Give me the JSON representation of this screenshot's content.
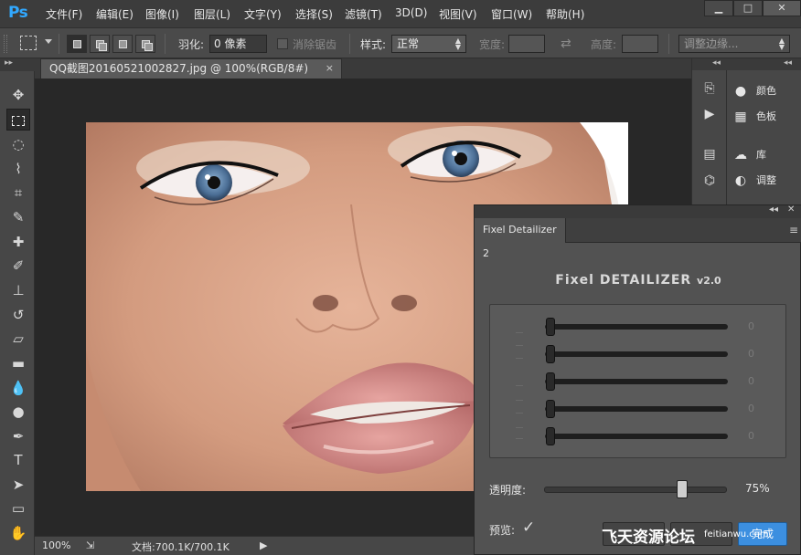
{
  "app": {
    "logo": "Ps"
  },
  "menu": [
    "文件(F)",
    "编辑(E)",
    "图像(I)",
    "图层(L)",
    "文字(Y)",
    "选择(S)",
    "滤镜(T)",
    "3D(D)",
    "视图(V)",
    "窗口(W)",
    "帮助(H)"
  ],
  "window_controls": {
    "minimize": "▁",
    "maximize": "□",
    "close": "✕"
  },
  "options": {
    "feather_label": "羽化:",
    "feather_value": "0 像素",
    "antialias_label": "消除锯齿",
    "style_label": "样式:",
    "style_value": "正常",
    "width_label": "宽度:",
    "height_label": "高度:",
    "refine_edge_button": "调整边缘..."
  },
  "document": {
    "tab_title": "QQ截图20160521002827.jpg @ 100%(RGB/8#)",
    "tab_close": "×"
  },
  "status": {
    "zoom": "100%",
    "doc_size": "文档:700.1K/700.1K"
  },
  "dock": {
    "panels": [
      {
        "label": "颜色",
        "icon": "palette-icon",
        "glyph": "●"
      },
      {
        "label": "色板",
        "icon": "swatches-icon",
        "glyph": "▦"
      },
      {
        "label": "库",
        "icon": "library-icon",
        "glyph": "☁"
      },
      {
        "label": "调整",
        "icon": "adjustments-icon",
        "glyph": "◐"
      }
    ]
  },
  "plugin": {
    "tab_label": "Fixel Detailizer 2",
    "title": "Fixel DETAILIZER",
    "version": "v2.0",
    "sliders": [
      {
        "value": "0"
      },
      {
        "value": "0"
      },
      {
        "value": "0"
      },
      {
        "value": "0"
      },
      {
        "value": "0"
      }
    ],
    "opacity_label": "透明度:",
    "opacity_value": "75%",
    "opacity_fraction": 0.75,
    "preview_label": "预览:",
    "preview_checked": true,
    "done_button": "完成",
    "watermark_text": "飞天资源论坛",
    "watermark_url": "feitianwu.com"
  },
  "colors": {
    "ps_blue": "#31a8ff",
    "panel_bg": "#525252",
    "primary_button": "#3c8fe0"
  }
}
